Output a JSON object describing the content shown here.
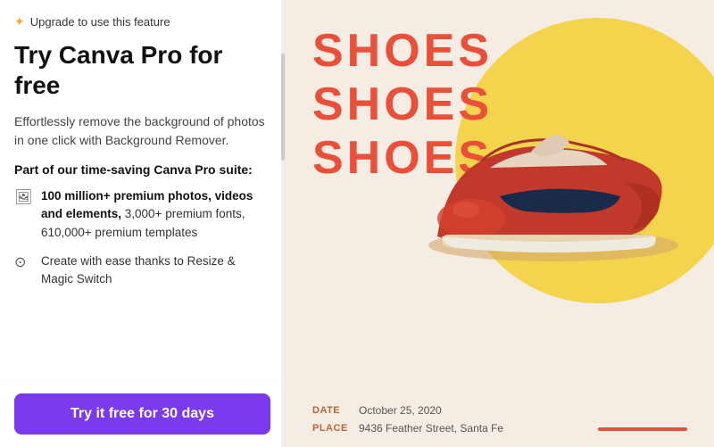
{
  "leftPanel": {
    "upgradeBadge": {
      "star": "✦",
      "text": "Upgrade to use this feature"
    },
    "heading": "Try Canva Pro for free",
    "description": "Effortlessly remove the background of photos in one click with Background Remover.",
    "suiteHeading": "Part of our time-saving Canva Pro suite:",
    "features": [
      {
        "icon": "🖼",
        "text": "100 million+ premium photos, videos and elements, 3,000+ premium fonts, 610,000+ premium templates",
        "boldPart": "100 million+ premium photos, videos and elements,"
      },
      {
        "icon": "⟳",
        "text": "Create with ease thanks to Resize & Magic Switch",
        "boldPart": ""
      }
    ],
    "ctaButton": "Try it free for 30 days"
  },
  "rightPanel": {
    "title": {
      "line1": "SHOES",
      "line2": "SHOES",
      "line3": "SHOES"
    },
    "infoBar": {
      "dateLabel": "DATE",
      "dateValue": "October 25, 2020",
      "placeLabel": "PLACE",
      "placeValue": "9436 Feather Street, Santa Fe"
    }
  }
}
